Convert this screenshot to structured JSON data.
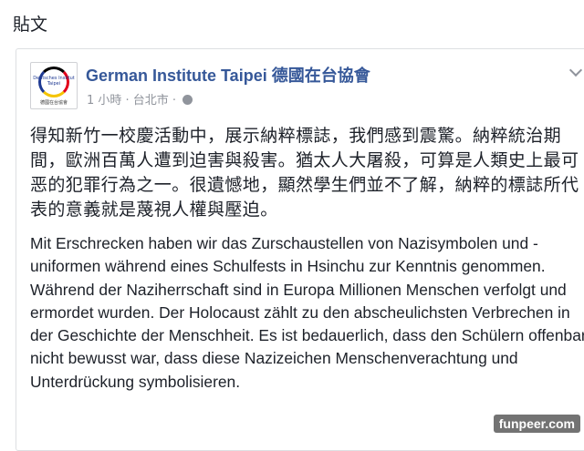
{
  "section_label": "貼文",
  "post": {
    "page_name": "German Institute Taipei 德國在台協會",
    "timestamp": "1 小時 · 台北市 ·",
    "avatar_text": "Deutsches Institut Taipei",
    "avatar_caption": "德國在台協會",
    "body_zh": "得知新竹一校慶活動中，展示納粹標誌，我們感到震驚。納粹統治期間，歐洲百萬人遭到迫害與殺害。猶太人大屠殺，可算是人類史上最可恶的犯罪行為之一。很遺憾地，顯然學生們並不了解，納粹的標誌所代表的意義就是蔑視人權與壓迫。",
    "body_de": "Mit Erschrecken haben wir das Zurschaustellen von Nazisymbolen und -uniformen während eines Schulfests in Hsinchu zur Kenntnis genommen. Während der Naziherrschaft sind in Europa Millionen Menschen verfolgt und ermordet wurden. Der Holocaust zählt zu den abscheulichsten Verbrechen in der Geschichte der Menschheit. Es ist bedauerlich, dass den Schülern offenbar nicht bewusst war, dass diese Nazizeichen Menschenverachtung und Unterdrückung symbolisieren."
  },
  "watermark": "funpeer.com",
  "icons": {
    "privacy": "globe-icon",
    "options": "chevron-down-icon"
  }
}
